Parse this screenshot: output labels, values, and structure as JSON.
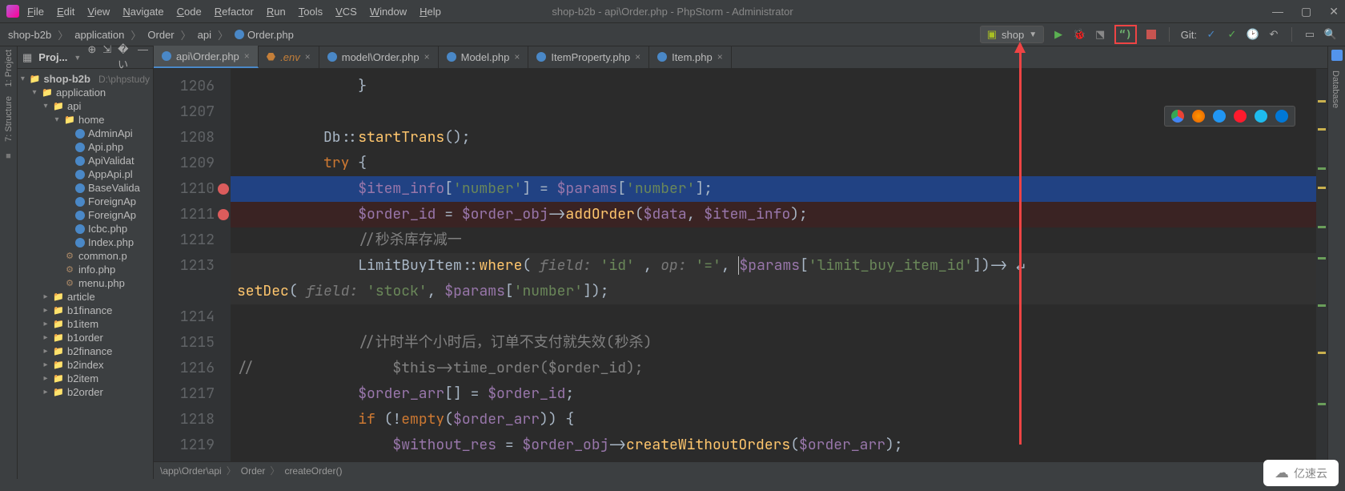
{
  "title": "shop-b2b - api\\Order.php - PhpStorm - Administrator",
  "menu": [
    "File",
    "Edit",
    "View",
    "Navigate",
    "Code",
    "Refactor",
    "Run",
    "Tools",
    "VCS",
    "Window",
    "Help"
  ],
  "breadcrumb": [
    "shop-b2b",
    "application",
    "Order",
    "api",
    "Order.php"
  ],
  "run_config": "shop",
  "git_label": "Git:",
  "left_rail": [
    "1: Project",
    "7: Structure"
  ],
  "right_rail": "Database",
  "panel": {
    "title": "Proj..."
  },
  "tree": {
    "root": "shop-b2b",
    "root_path": "D:\\phpstudy",
    "nodes": [
      {
        "depth": 1,
        "type": "dir",
        "name": "application",
        "open": true
      },
      {
        "depth": 2,
        "type": "dir",
        "name": "api",
        "open": true
      },
      {
        "depth": 3,
        "type": "dir",
        "name": "home",
        "open": true
      },
      {
        "depth": 4,
        "type": "php",
        "name": "AdminApi"
      },
      {
        "depth": 4,
        "type": "php",
        "name": "Api.php"
      },
      {
        "depth": 4,
        "type": "php",
        "name": "ApiValidat"
      },
      {
        "depth": 4,
        "type": "php",
        "name": "AppApi.pl"
      },
      {
        "depth": 4,
        "type": "php",
        "name": "BaseValida"
      },
      {
        "depth": 4,
        "type": "php",
        "name": "ForeignAp"
      },
      {
        "depth": 4,
        "type": "php",
        "name": "ForeignAp"
      },
      {
        "depth": 4,
        "type": "php",
        "name": "Icbc.php"
      },
      {
        "depth": 4,
        "type": "php",
        "name": "Index.php"
      },
      {
        "depth": 3,
        "type": "cfg",
        "name": "common.p"
      },
      {
        "depth": 3,
        "type": "cfg",
        "name": "info.php"
      },
      {
        "depth": 3,
        "type": "cfg",
        "name": "menu.php"
      },
      {
        "depth": 2,
        "type": "dir",
        "name": "article",
        "open": false
      },
      {
        "depth": 2,
        "type": "dir",
        "name": "b1finance",
        "open": false
      },
      {
        "depth": 2,
        "type": "dir",
        "name": "b1item",
        "open": false
      },
      {
        "depth": 2,
        "type": "dir",
        "name": "b1order",
        "open": false
      },
      {
        "depth": 2,
        "type": "dir",
        "name": "b2finance",
        "open": false
      },
      {
        "depth": 2,
        "type": "dir",
        "name": "b2index",
        "open": false
      },
      {
        "depth": 2,
        "type": "dir",
        "name": "b2item",
        "open": false
      },
      {
        "depth": 2,
        "type": "dir",
        "name": "b2order",
        "open": false
      }
    ]
  },
  "tabs": [
    {
      "label": "api\\Order.php",
      "icon": "php",
      "active": true
    },
    {
      "label": ".env",
      "icon": "env",
      "active": false
    },
    {
      "label": "model\\Order.php",
      "icon": "php",
      "active": false
    },
    {
      "label": "Model.php",
      "icon": "php",
      "active": false
    },
    {
      "label": "ItemProperty.php",
      "icon": "php",
      "active": false
    },
    {
      "label": "Item.php",
      "icon": "php",
      "active": false
    }
  ],
  "lines": {
    "start": 1206,
    "rows": [
      {
        "n": 1206,
        "html": "              }"
      },
      {
        "n": 1207,
        "html": ""
      },
      {
        "n": 1208,
        "html": "          Db::<span class='fn'>startTrans</span>();"
      },
      {
        "n": 1209,
        "html": "          <span class='kw'>try</span> {"
      },
      {
        "n": 1210,
        "html": "              <span class='var'>$item_info</span>[<span class='str'>'number'</span>] = <span class='var'>$params</span>[<span class='str'>'number'</span>];",
        "cls": "sel-blue",
        "bp": true
      },
      {
        "n": 1211,
        "html": "              <span class='var'>$order_id</span> = <span class='var'>$order_obj</span>-><span class='fn'>addOrder</span>(<span class='var'>$data</span>, <span class='var'>$item_info</span>);",
        "cls": "bp-line",
        "bp": true
      },
      {
        "n": 1212,
        "html": "              <span class='cm'>//秒杀库存减一</span>"
      },
      {
        "n": 1213,
        "html": "              LimitBuyItem::<span class='fn'>where</span>( <span class='hint'>field:</span> <span class='str'>'id'</span> , <span class='hint'>op:</span> <span class='str'>'='</span>, <span class='caret'></span><span class='var'>$params</span>[<span class='str'>'limit_buy_item_id'</span>])-> &#8629;",
        "cls": "cur"
      },
      {
        "n": 0,
        "html": "<span class='fn'>setDec</span>( <span class='hint'>field:</span> <span class='str'>'stock'</span>, <span class='var'>$params</span>[<span class='str'>'number'</span>]);",
        "cls": "cur",
        "wrap": true
      },
      {
        "n": 1214,
        "html": ""
      },
      {
        "n": 1215,
        "html": "              <span class='cm'>//计时半个小时后，订单不支付就失效(秒杀)</span>"
      },
      {
        "n": 1216,
        "html": "<span class='cm'>//                $this->time_order($order_id);</span>"
      },
      {
        "n": 1217,
        "html": "              <span class='var'>$order_arr</span>[] = <span class='var'>$order_id</span>;"
      },
      {
        "n": 1218,
        "html": "              <span class='kw'>if</span> (!<span class='kw'>empty</span>(<span class='var'>$order_arr</span>)) {"
      },
      {
        "n": 1219,
        "html": "                  <span class='var'>$without_res</span> = <span class='var'>$order_obj</span>-><span class='fn'>createWithoutOrders</span>(<span class='var'>$order_arr</span>);"
      }
    ]
  },
  "bottom_crumbs": [
    "\\app\\Order\\api",
    "Order",
    "createOrder()"
  ],
  "watermark": "亿速云"
}
